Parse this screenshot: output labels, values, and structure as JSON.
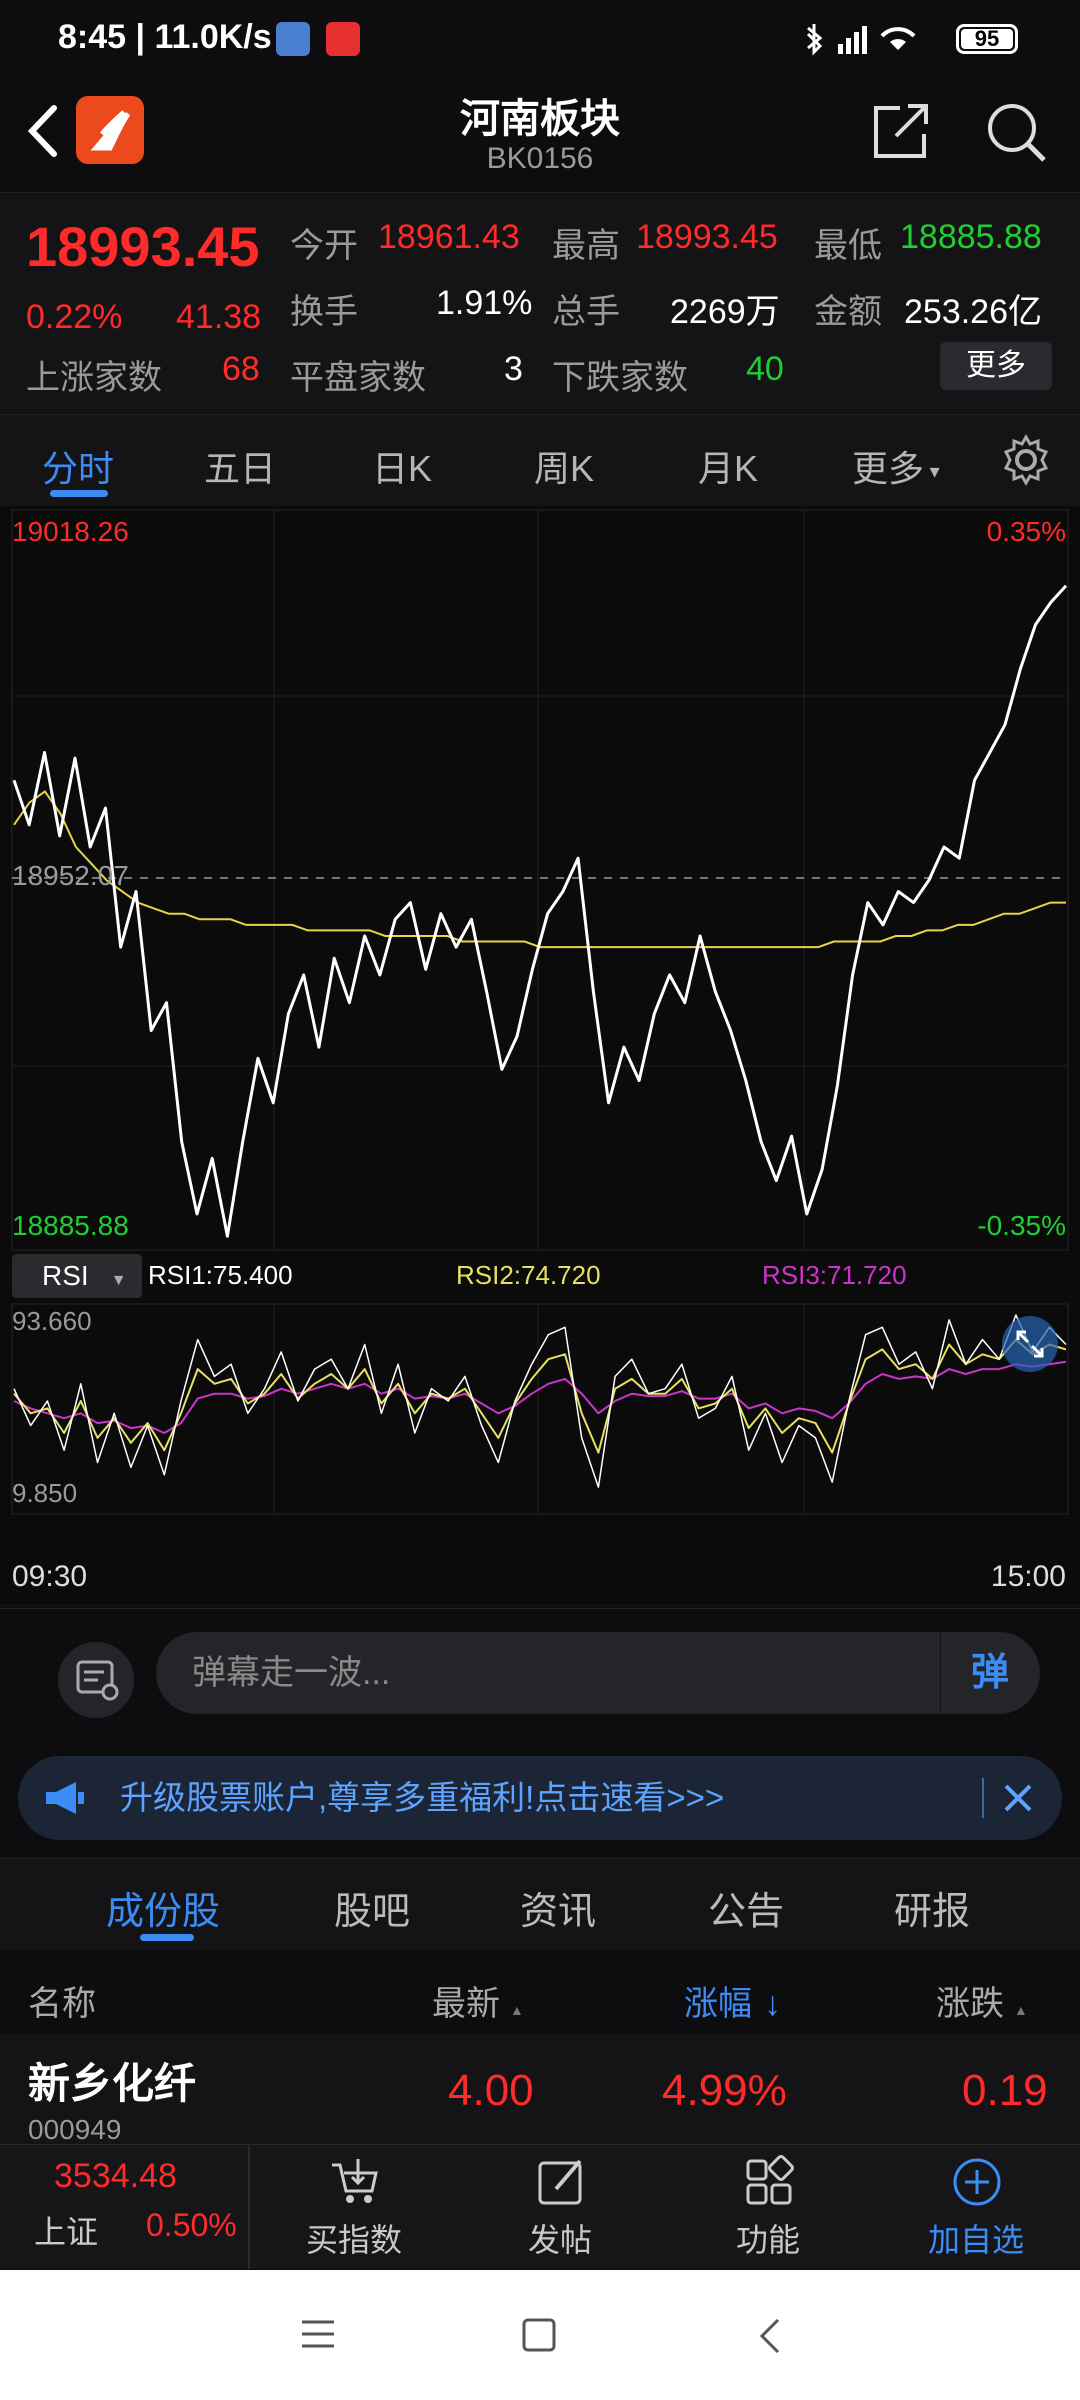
{
  "status_bar": {
    "time": "8:45 | 11.0K/s",
    "battery": "95"
  },
  "header": {
    "title": "河南板块",
    "code": "BK0156"
  },
  "quote": {
    "price": "18993.45",
    "change_pct": "0.22%",
    "change": "41.38",
    "open_label": "今开",
    "open": "18961.43",
    "high_label": "最高",
    "high": "18993.45",
    "low_label": "最低",
    "low": "18885.88",
    "turnover_label": "换手",
    "turnover": "1.91%",
    "volume_label": "总手",
    "volume": "2269万",
    "amount_label": "金额",
    "amount": "253.26亿",
    "up_label": "上涨家数",
    "up": "68",
    "flat_label": "平盘家数",
    "flat": "3",
    "down_label": "下跌家数",
    "down": "40",
    "more_label": "更多"
  },
  "tabs": [
    "分时",
    "五日",
    "日K",
    "周K",
    "月K",
    "更多"
  ],
  "chart": {
    "y_top": "19018.26",
    "y_mid": "18952.07",
    "y_bottom": "18885.88",
    "pct_top": "0.35%",
    "pct_bottom": "-0.35%",
    "rsi_select": "RSI",
    "rsi1": "RSI1:75.400",
    "rsi2": "RSI2:74.720",
    "rsi3": "RSI3:71.720",
    "rsi_top": "93.660",
    "rsi_bottom": "9.850",
    "time_start": "09:30",
    "time_end": "15:00",
    "colors": {
      "price": "#ffffff",
      "avg": "#e8d44a",
      "rsi1": "#ffffff",
      "rsi2": "#e8e060",
      "rsi3": "#cc33cc"
    }
  },
  "chart_data": {
    "type": "line",
    "ylim": [
      18885.88,
      19018.26
    ],
    "series": [
      {
        "values": [
          18970,
          18962,
          18975,
          18960,
          18974,
          18958,
          18965,
          18940,
          18950,
          18925,
          18930,
          18905,
          18892,
          18902,
          18888,
          18905,
          18920,
          18912,
          18928,
          18935,
          18922,
          18938,
          18930,
          18942,
          18935,
          18945,
          18948,
          18936,
          18946,
          18940,
          18945,
          18932,
          18918,
          18924,
          18936,
          18946,
          18950,
          18956,
          18932,
          18912,
          18922,
          18916,
          18928,
          18935,
          18930,
          18942,
          18932,
          18925,
          18916,
          18905,
          18898,
          18906,
          18892,
          18900,
          18915,
          18935,
          18948,
          18944,
          18950,
          18948,
          18952,
          18958,
          18956,
          18970,
          18975,
          18980,
          18990,
          18998,
          19002,
          19005
        ]
      },
      {
        "values": [
          18962,
          18966,
          18968,
          18964,
          18958,
          18955,
          18952,
          18950,
          18948,
          18947,
          18946,
          18946,
          18945,
          18945,
          18945,
          18944,
          18944,
          18944,
          18944,
          18943,
          18943,
          18943,
          18943,
          18943,
          18942,
          18942,
          18942,
          18942,
          18942,
          18941,
          18941,
          18941,
          18941,
          18941,
          18940,
          18940,
          18940,
          18940,
          18940,
          18940,
          18940,
          18940,
          18940,
          18940,
          18940,
          18940,
          18940,
          18940,
          18940,
          18940,
          18940,
          18940,
          18940,
          18941,
          18941,
          18941,
          18941,
          18942,
          18942,
          18943,
          18943,
          18944,
          18944,
          18945,
          18946,
          18946,
          18947,
          18948,
          18948
        ]
      }
    ],
    "rsi": {
      "ylim": [
        9.85,
        93.66
      ],
      "series": [
        {
          "values": [
            60,
            45,
            55,
            35,
            62,
            30,
            50,
            28,
            45,
            25,
            55,
            80,
            65,
            70,
            50,
            60,
            75,
            55,
            68,
            72,
            60,
            78,
            50,
            70,
            42,
            60,
            55,
            65,
            45,
            30,
            55,
            70,
            82,
            85,
            40,
            20,
            65,
            72,
            58,
            60,
            70,
            48,
            52,
            65,
            35,
            50,
            30,
            45,
            40,
            22,
            55,
            82,
            85,
            70,
            75,
            60,
            88,
            70,
            80,
            72,
            90,
            75,
            85,
            78
          ]
        },
        {
          "values": [
            58,
            50,
            52,
            42,
            55,
            40,
            48,
            38,
            46,
            35,
            50,
            68,
            62,
            64,
            54,
            58,
            66,
            56,
            62,
            66,
            60,
            68,
            54,
            62,
            50,
            58,
            56,
            60,
            50,
            40,
            54,
            64,
            72,
            74,
            50,
            34,
            60,
            64,
            58,
            58,
            64,
            52,
            54,
            60,
            44,
            52,
            42,
            48,
            46,
            34,
            54,
            72,
            76,
            68,
            70,
            64,
            78,
            70,
            74,
            72,
            80,
            74,
            78,
            76
          ]
        },
        {
          "values": [
            55,
            52,
            50,
            48,
            50,
            46,
            47,
            44,
            45,
            42,
            46,
            56,
            58,
            58,
            56,
            57,
            60,
            58,
            60,
            62,
            60,
            62,
            58,
            60,
            56,
            57,
            56,
            58,
            54,
            50,
            53,
            58,
            62,
            64,
            58,
            50,
            55,
            58,
            57,
            57,
            59,
            56,
            56,
            58,
            52,
            54,
            50,
            52,
            51,
            48,
            54,
            62,
            66,
            64,
            65,
            64,
            68,
            66,
            68,
            68,
            70,
            69,
            70,
            71
          ]
        }
      ]
    }
  },
  "danmu": {
    "placeholder": "弹幕走一波...",
    "button": "弹"
  },
  "banner": {
    "text": "升级股票账户,尊享多重福利!点击速看>>>"
  },
  "subtabs": [
    "成份股",
    "股吧",
    "资讯",
    "公告",
    "研报"
  ],
  "table": {
    "headers": [
      "名称",
      "最新",
      "涨幅",
      "涨跌"
    ],
    "rows": [
      {
        "name": "新乡化纤",
        "code": "000949",
        "last": "4.00",
        "pct": "4.99%",
        "chg": "0.19"
      }
    ]
  },
  "bottom_bar": {
    "index_value": "3534.48",
    "index_name": "上证",
    "index_pct": "0.50%",
    "items": [
      "买指数",
      "发帖",
      "功能",
      "加自选"
    ]
  }
}
